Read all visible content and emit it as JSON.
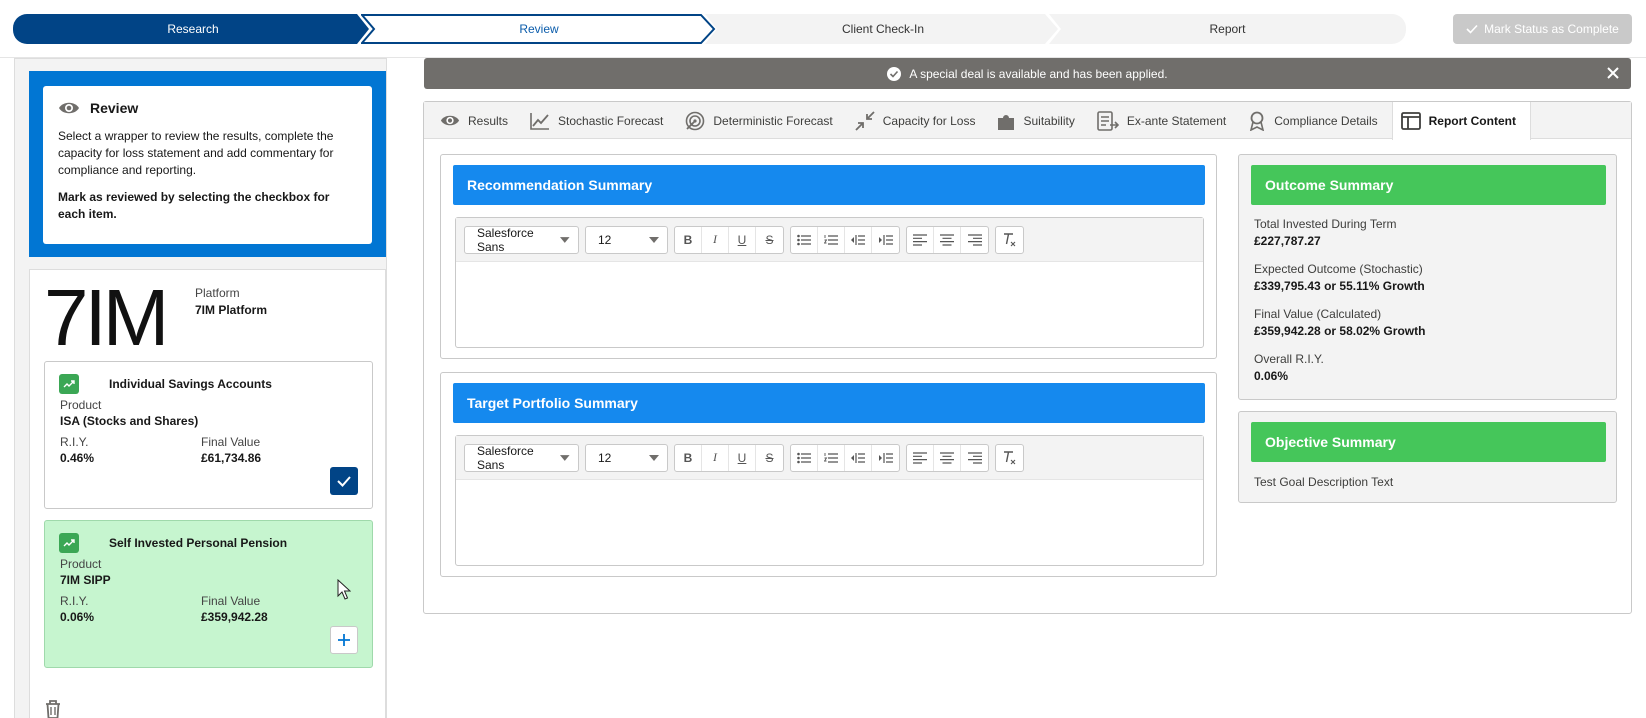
{
  "path": {
    "steps": [
      "Research",
      "Review",
      "Client Check-In",
      "Report"
    ],
    "mark_complete_label": "Mark Status as Complete"
  },
  "colors": {
    "brand_blue": "#0176d3",
    "dark_blue": "#014486",
    "header_blue": "#1589ee",
    "green": "#45c65a",
    "selected_card": "#c6f5cf"
  },
  "review": {
    "title": "Review",
    "instructions": "Select a wrapper to review the results, complete the capacity for loss statement and add commentary for compliance and reporting.",
    "bold_note": "Mark as reviewed by selecting the checkbox for each item."
  },
  "platform": {
    "logo_text": "7IM",
    "label": "Platform",
    "value": "7IM Platform"
  },
  "wrappers": [
    {
      "title": "Individual Savings Accounts",
      "product_label": "Product",
      "product": "ISA (Stocks and Shares)",
      "riy_label": "R.I.Y.",
      "riy": "0.46%",
      "final_label": "Final Value",
      "final_value": "£61,734.86",
      "reviewed": true
    },
    {
      "title": "Self Invested Personal Pension",
      "product_label": "Product",
      "product": "7IM SIPP",
      "riy_label": "R.I.Y.",
      "riy": "0.06%",
      "final_label": "Final Value",
      "final_value": "£359,942.28",
      "reviewed": false
    }
  ],
  "banner": {
    "text": "A special deal is available and has been applied."
  },
  "tabs": [
    {
      "label": "Results",
      "icon": "eye-icon"
    },
    {
      "label": "Stochastic Forecast",
      "icon": "line-chart-icon"
    },
    {
      "label": "Deterministic Forecast",
      "icon": "target-icon"
    },
    {
      "label": "Capacity for Loss",
      "icon": "contract-arrows-icon"
    },
    {
      "label": "Suitability",
      "icon": "puzzle-icon"
    },
    {
      "label": "Ex-ante Statement",
      "icon": "statement-icon"
    },
    {
      "label": "Compliance Details",
      "icon": "award-icon"
    },
    {
      "label": "Report Content",
      "icon": "layout-icon",
      "active": true
    }
  ],
  "editors": [
    {
      "title": "Recommendation Summary",
      "font": "Salesforce Sans",
      "size": "12"
    },
    {
      "title": "Target Portfolio Summary",
      "font": "Salesforce Sans",
      "size": "12"
    }
  ],
  "outcome": {
    "title": "Outcome Summary",
    "items": [
      {
        "label": "Total Invested During Term",
        "value": "£227,787.27"
      },
      {
        "label": "Expected Outcome (Stochastic)",
        "value": "£339,795.43 or 55.11% Growth"
      },
      {
        "label": "Final Value (Calculated)",
        "value": "£359,942.28 or 58.02% Growth"
      },
      {
        "label": "Overall R.I.Y.",
        "value": "0.06%"
      }
    ]
  },
  "objective": {
    "title": "Objective Summary",
    "text": "Test Goal Description Text"
  }
}
